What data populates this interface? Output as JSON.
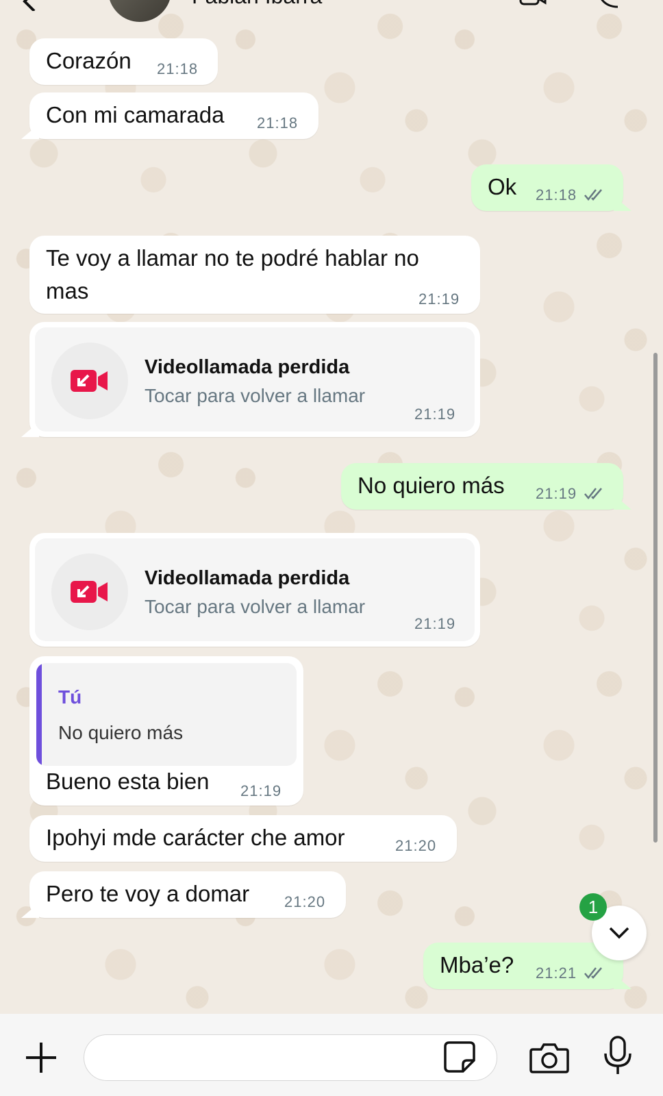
{
  "header": {
    "contact_name": "Fabian Ibarra"
  },
  "messages": [
    {
      "text": "Corazón",
      "time": "21:18"
    },
    {
      "text": "Con mi camarada",
      "time": "21:18"
    },
    {
      "text": "Ok",
      "time": "21:18"
    },
    {
      "line1": "Te voy a llamar no te podré hablar no",
      "line2": "mas",
      "time": "21:19"
    },
    {
      "title": "Videollamada perdida",
      "subtitle": "Tocar para volver a llamar",
      "time": "21:19"
    },
    {
      "text": "No quiero más",
      "time": "21:19"
    },
    {
      "title": "Videollamada perdida",
      "subtitle": "Tocar para volver a llamar",
      "time": "21:19"
    },
    {
      "quote_author": "Tú",
      "quote_text": "No quiero más",
      "text": "Bueno esta bien",
      "time": "21:19"
    },
    {
      "text": "Ipohyi mde carácter che amor",
      "time": "21:20"
    },
    {
      "text": "Pero te voy a domar",
      "time": "21:20"
    },
    {
      "text": "Mba’e?",
      "time": "21:21"
    }
  ],
  "unread_count": "1",
  "colors": {
    "outgoing_bubble": "#d9fdd3",
    "incoming_bubble": "#ffffff",
    "missed_call_red": "#e8174a",
    "quote_accent": "#6e4fdc",
    "badge_green": "#25a244"
  },
  "icons": [
    "back-arrow-icon",
    "video-call-icon",
    "phone-icon",
    "missed-video-call-icon",
    "read-ticks-icon",
    "chevron-down-icon",
    "plus-icon",
    "sticker-icon",
    "camera-icon",
    "microphone-icon"
  ]
}
